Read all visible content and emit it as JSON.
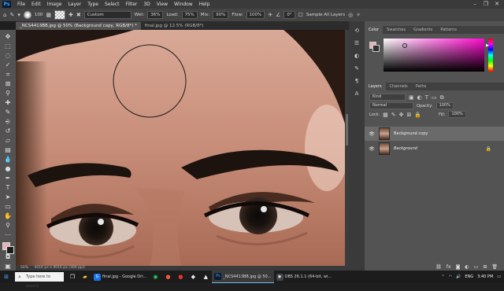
{
  "menu": {
    "logo": "Ps",
    "items": [
      "File",
      "Edit",
      "Image",
      "Layer",
      "Type",
      "Select",
      "Filter",
      "3D",
      "View",
      "Window",
      "Help"
    ],
    "window_controls": [
      "–",
      "❐",
      "✕"
    ]
  },
  "options": {
    "brush_size": "100",
    "preset": "Custom",
    "wet_label": "Wet:",
    "wet_value": "36%",
    "load_label": "Load:",
    "load_value": "75%",
    "mix_label": "Mix:",
    "mix_value": "90%",
    "flow_label": "Flow:",
    "flow_value": "100%",
    "angle_value": "0°",
    "sample_all_layers": "Sample All Layers"
  },
  "tabs": [
    "_NCS4413BB.jpg @ 50% (Background copy, RGB/8*) *",
    "final.jpg @ 12.5% (RGB/8*)"
  ],
  "status": {
    "zoom": "50%",
    "doc_size": "4016 px x 4016 px (300 ppi)"
  },
  "color_panel": {
    "tabs": [
      "Color",
      "Swatches",
      "Gradients",
      "Patterns"
    ],
    "hue_color": "#ff0ad0",
    "foreground": "#e8b0b7",
    "background": "#303030"
  },
  "layers_panel": {
    "tabs": [
      "Layers",
      "Channels",
      "Paths"
    ],
    "kind_label": "Kind",
    "blend_mode": "Normal",
    "opacity_label": "Opacity:",
    "opacity_value": "100%",
    "lock_label": "Lock:",
    "fill_label": "Fill:",
    "fill_value": "100%",
    "layers": [
      {
        "name": "Background copy",
        "selected": true
      },
      {
        "name": "Background",
        "selected": false
      }
    ]
  },
  "taskbar": {
    "search_placeholder": "Type here to search",
    "apps": [
      {
        "label": "final.jpg - Google Dri...",
        "color": "#1a73e8",
        "glyph": "G"
      },
      {
        "label": "_NCS4413BB.jpg @ 50...",
        "color": "#0d1b33",
        "glyph": "Ps"
      },
      {
        "label": "OBS 26.1.1 (64-bit, wi...",
        "color": "#444444",
        "glyph": "◉"
      }
    ],
    "time": "3:40 PM",
    "lang": "ENG"
  }
}
